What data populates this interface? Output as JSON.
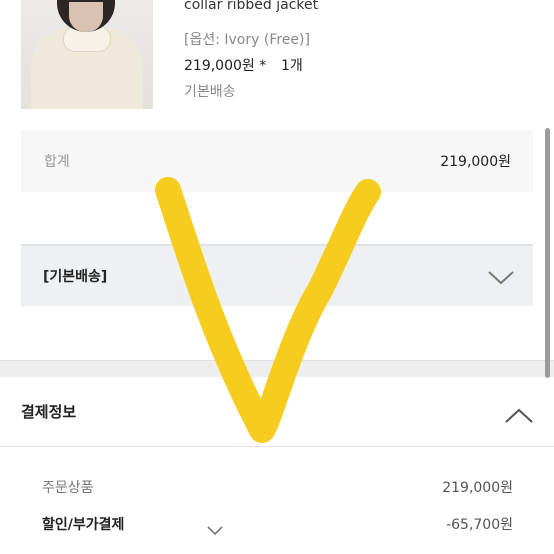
{
  "product": {
    "name": "collar ribbed jacket",
    "option": "[옵션: Ivory (Free)]",
    "price": "219,000원 *",
    "quantity": "1개",
    "shipping": "기본배송",
    "image_icon": "product-photo"
  },
  "summary": {
    "total_label": "합계",
    "total_value": "219,000원"
  },
  "shipping_section": {
    "label": "[기본배송]",
    "chevron_icon": "chevron-down-icon"
  },
  "payment": {
    "title": "결제정보",
    "chevron_icon": "chevron-up-icon",
    "rows": [
      {
        "label": "주문상품",
        "value": "219,000원"
      },
      {
        "label": "할인/부가결제",
        "value": "-65,700원"
      }
    ]
  },
  "colors": {
    "marker": "#f5c913",
    "panel": "#f7f7f7",
    "panel_alt": "#eef0f2"
  }
}
